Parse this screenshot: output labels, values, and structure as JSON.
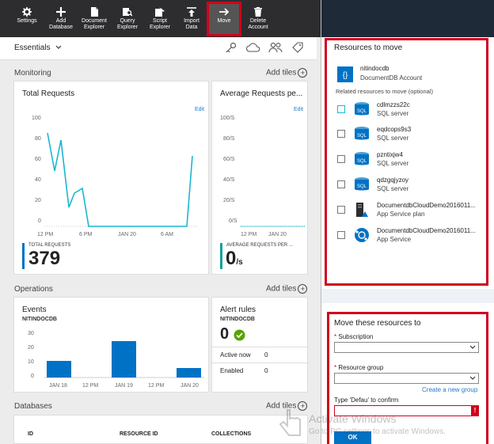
{
  "toolbar": {
    "items": [
      {
        "label": "Settings",
        "icon": "gear-icon"
      },
      {
        "label": "Add\nDatabase",
        "icon": "plus-icon"
      },
      {
        "label": "Document\nExplorer",
        "icon": "document-icon"
      },
      {
        "label": "Query\nExplorer",
        "icon": "query-icon"
      },
      {
        "label": "Script\nExplorer",
        "icon": "script-icon"
      },
      {
        "label": "Import\nData",
        "icon": "import-icon"
      },
      {
        "label": "Move",
        "icon": "arrow-right-icon"
      },
      {
        "label": "Delete\nAccount",
        "icon": "trash-icon"
      }
    ]
  },
  "essentials": {
    "label": "Essentials"
  },
  "monitoring": {
    "title": "Monitoring",
    "add_tiles": "Add tiles",
    "total_requests": {
      "title": "Total Requests",
      "edit": "Edit",
      "y_ticks": [
        "100",
        "80",
        "60",
        "40",
        "20",
        "0"
      ],
      "x_ticks": [
        "12 PM",
        "6 PM",
        "JAN 20",
        "6 AM"
      ],
      "metric_label": "TOTAL REQUESTS",
      "metric_value": "379"
    },
    "avg_requests": {
      "title": "Average Requests pe...",
      "edit": "Edit",
      "y_ticks": [
        "100/S",
        "80/S",
        "60/S",
        "40/S",
        "20/S",
        "0/S"
      ],
      "x_ticks": [
        "12 PM",
        "JAN 20"
      ],
      "metric_label": "AVERAGE REQUESTS PER ...",
      "metric_value": "0",
      "metric_unit": "/s"
    }
  },
  "operations": {
    "title": "Operations",
    "add_tiles": "Add tiles",
    "events": {
      "title": "Events",
      "subtitle": "NITINDOCDB",
      "y_ticks": [
        "30",
        "20",
        "10",
        "0"
      ],
      "x_ticks": [
        "JAN 18",
        "12 PM",
        "JAN 19",
        "12 PM",
        "JAN 20"
      ]
    },
    "alert_rules": {
      "title": "Alert rules",
      "subtitle": "NITINDOCDB",
      "count": "0",
      "rows": [
        {
          "label": "Active now",
          "value": "0"
        },
        {
          "label": "Enabled",
          "value": "0"
        }
      ]
    }
  },
  "databases": {
    "title": "Databases",
    "add_tiles": "Add tiles",
    "columns": [
      "ID",
      "RESOURCE ID",
      "COLLECTIONS"
    ]
  },
  "resources_panel": {
    "title": "Resources to move",
    "account": {
      "name": "nitindocdb",
      "type": "DocumentDB Account"
    },
    "related_label": "Related resources to move (optional)",
    "items": [
      {
        "name": "cdlmzzs22c",
        "type": "SQL server",
        "icon": "sql-server-icon"
      },
      {
        "name": "eqdcops9s3",
        "type": "SQL server",
        "icon": "sql-server-icon"
      },
      {
        "name": "pzntixjw4",
        "type": "SQL server",
        "icon": "sql-server-icon"
      },
      {
        "name": "qdzgqjyzoy",
        "type": "SQL server",
        "icon": "sql-server-icon"
      },
      {
        "name": "DocumentdbCloudDemo2016011...",
        "type": "App Service plan",
        "icon": "app-service-plan-icon"
      },
      {
        "name": "DocumentdbCloudDemo2016011...",
        "type": "App Service",
        "icon": "app-service-icon"
      }
    ]
  },
  "move_panel": {
    "title": "Move these resources to",
    "subscription_label": "Subscription",
    "resource_group_label": "Resource group",
    "create_group_link": "Create a new group",
    "confirm_label": "Type 'Defau' to confirm",
    "ok_label": "OK"
  },
  "watermark": {
    "line1": "Activate Windows",
    "line2": "Go to PC settings to activate Windows."
  },
  "colors": {
    "accent": "#0072c6",
    "chart_line": "#1ab7d1",
    "alert_red": "#d0021b",
    "ok_green": "#57a300",
    "teal": "#11a09a"
  }
}
